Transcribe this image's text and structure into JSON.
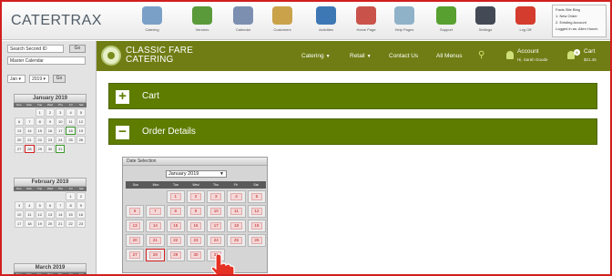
{
  "app": {
    "logo": "CATERTRAX"
  },
  "toolbar": {
    "items": [
      {
        "label": "Catering",
        "color": "#7aa0c8"
      },
      {
        "label": "Vendors",
        "color": "#5a9a3a"
      },
      {
        "label": "Calendar",
        "color": "#7c8fb1"
      },
      {
        "label": "Customers",
        "color": "#c9a24a"
      },
      {
        "label": "Activities",
        "color": "#3d78b5"
      },
      {
        "label": "Home Page",
        "color": "#c9534b"
      },
      {
        "label": "Help Pages",
        "color": "#8fb2c8"
      },
      {
        "label": "Support",
        "color": "#58a030"
      },
      {
        "label": "Settings",
        "color": "#444a55"
      },
      {
        "label": "Log Off",
        "color": "#d43c2d"
      }
    ],
    "quick_links": [
      "Facts Site Blog",
      "1. New Order",
      "2. Existing Account",
      "Logged in as: Allen Hunch"
    ]
  },
  "sidebar": {
    "search_label": "Search Second ID",
    "go_label": "Go",
    "calendar_select": "Master Calendar",
    "month_select": "Jan",
    "year_select": "2019",
    "go2_label": "Go",
    "weekdays": [
      "Sun",
      "Mon",
      "Tue",
      "Wed",
      "Thu",
      "Fri",
      "Sat"
    ],
    "months": [
      {
        "title": "January 2019",
        "days": [
          "",
          "",
          "1",
          "2",
          "3",
          "4",
          "5",
          "6",
          "7",
          "8",
          "9",
          "10",
          "11",
          "12",
          "13",
          "14",
          "15",
          "16",
          "17",
          "18",
          "19",
          "20",
          "21",
          "22",
          "23",
          "24",
          "25",
          "26",
          "27",
          "28",
          "29",
          "30",
          "31",
          "",
          ""
        ]
      },
      {
        "title": "February 2019",
        "days": [
          "",
          "",
          "",
          "",
          "",
          "1",
          "2",
          "3",
          "4",
          "5",
          "6",
          "7",
          "8",
          "9",
          "10",
          "11",
          "12",
          "13",
          "14",
          "15",
          "16",
          "17",
          "18",
          "19",
          "20",
          "21",
          "22",
          "23"
        ]
      },
      {
        "title": "March 2019"
      }
    ]
  },
  "header": {
    "brand_line1": "CLASSIC FARE",
    "brand_line2": "CATERING",
    "nav": [
      {
        "label": "Catering",
        "caret": "▼"
      },
      {
        "label": "Retail",
        "caret": "▼"
      },
      {
        "label": "Contact Us",
        "caret": ""
      },
      {
        "label": "All Menus",
        "caret": ""
      }
    ],
    "account_label": "Account",
    "account_user": "Hi, Sarah Goode",
    "cart_label": "Cart",
    "cart_total": "$21.45",
    "cart_count": "0"
  },
  "sections": {
    "cart": {
      "icon": "+",
      "label": "Cart"
    },
    "order_details": {
      "icon": "−",
      "label": "Order Details"
    }
  },
  "date_selection": {
    "title": "Date Selection",
    "month_value": "January 2019",
    "weekdays": [
      "Sun",
      "Mon",
      "Tue",
      "Wed",
      "Thu",
      "Fri",
      "Sat"
    ],
    "days": [
      "",
      "",
      "1",
      "2",
      "3",
      "4",
      "5",
      "6",
      "7",
      "8",
      "9",
      "10",
      "11",
      "12",
      "13",
      "14",
      "15",
      "16",
      "17",
      "18",
      "19",
      "20",
      "21",
      "22",
      "23",
      "24",
      "25",
      "26",
      "27",
      "28",
      "29",
      "30",
      "31",
      "",
      ""
    ]
  }
}
